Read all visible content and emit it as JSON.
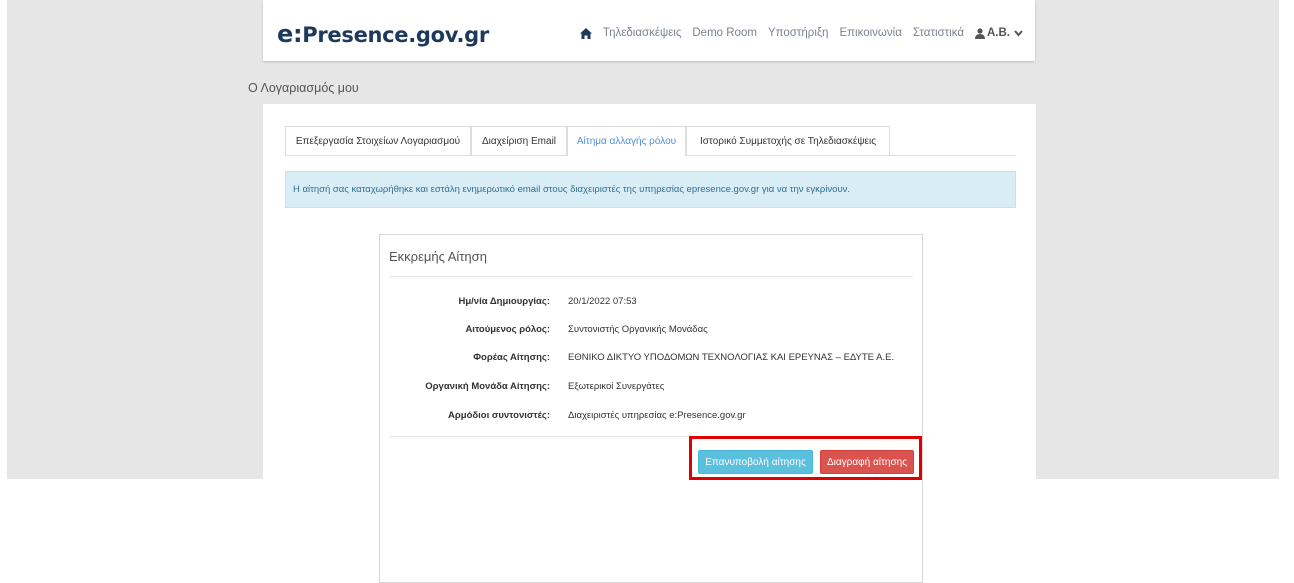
{
  "header": {
    "brand_prefix": "e:",
    "brand_rest": "Presence.gov.gr",
    "nav": {
      "home_icon": "home-icon",
      "conferences": "Τηλεδιασκέψεις",
      "demo_room": "Demo Room",
      "support": "Υποστήριξη",
      "contact": "Επικοινωνία",
      "statistics": "Στατιστικά",
      "user_icon": "user-icon",
      "user": "A.B.",
      "user_menu_icon": "chevron-down-icon"
    }
  },
  "page": {
    "title": "Ο Λογαριασμός μου"
  },
  "tabs": [
    {
      "label": "Επεξεργασία Στοιχείων Λογαριασμού",
      "active": false
    },
    {
      "label": "Διαχείριση Email",
      "active": false
    },
    {
      "label": "Αίτημα αλλαγής ρόλου",
      "active": true
    },
    {
      "label": "Ιστορικό Συμμετοχής σε Τηλεδιασκέψεις",
      "active": false
    }
  ],
  "alert": {
    "text": "Η αίτησή σας καταχωρήθηκε και εστάλη ενημερωτικό email στους διαχειριστές της υπηρεσίας epresence.gov.gr για να την εγκρίνουν."
  },
  "request": {
    "title": "Εκκρεμής Αίτηση",
    "fields": [
      {
        "label": "Ημ/νία Δημιουργίας:",
        "value": "20/1/2022 07:53"
      },
      {
        "label": "Αιτούμενος ρόλος:",
        "value": "Συντονιστής Οργανικής Μονάδας"
      },
      {
        "label": "Φορέας Αίτησης:",
        "value": "ΕΘΝΙΚΟ ΔΙΚΤΥΟ ΥΠΟΔΟΜΩΝ ΤΕΧΝΟΛΟΓΙΑΣ ΚΑΙ ΕΡΕΥΝΑΣ – ΕΔΥΤΕ Α.Ε."
      },
      {
        "label": "Οργανική Μονάδα Αίτησης:",
        "value": "Εξωτερικοί Συνεργάτες"
      },
      {
        "label": "Αρμόδιοι συντονιστές:",
        "value": "Διαχειριστές υπηρεσίας e:Presence.gov.gr"
      }
    ],
    "resubmit_label": "Επανυποβολή αίτησης",
    "delete_label": "Διαγραφή αίτησης"
  },
  "colors": {
    "brand": "#1d3a5c",
    "active_tab": "#4a90d9",
    "alert_bg": "#d9edf7",
    "resubmit": "#5bc0de",
    "delete": "#d9534f",
    "highlight": "#e00000"
  }
}
